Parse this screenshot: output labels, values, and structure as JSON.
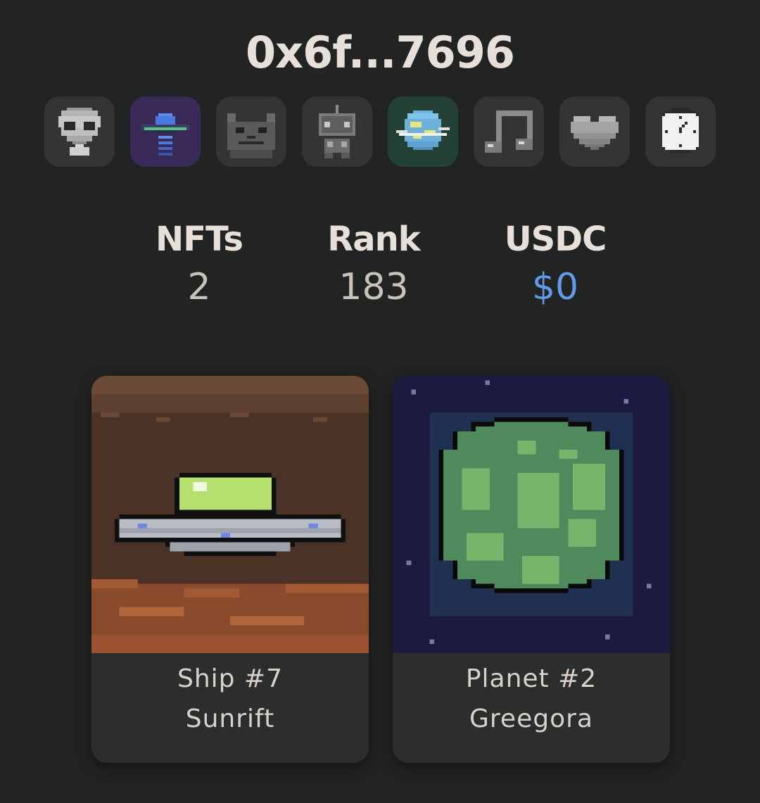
{
  "wallet": {
    "address": "0x6f...7696"
  },
  "badges": [
    {
      "name": "alien",
      "icon": "alien-icon"
    },
    {
      "name": "ufo",
      "icon": "ufo-icon"
    },
    {
      "name": "cat",
      "icon": "cat-icon"
    },
    {
      "name": "robot",
      "icon": "robot-icon"
    },
    {
      "name": "planet",
      "icon": "planet-icon"
    },
    {
      "name": "music",
      "icon": "music-note-icon"
    },
    {
      "name": "heart",
      "icon": "heart-icon"
    },
    {
      "name": "clock",
      "icon": "clock-icon"
    }
  ],
  "stats": {
    "nfts": {
      "label": "NFTs",
      "value": "2"
    },
    "rank": {
      "label": "Rank",
      "value": "183"
    },
    "usdc": {
      "label": "USDC",
      "value": "$0"
    }
  },
  "cards": [
    {
      "title": "Ship #7",
      "subtitle": "Sunrift",
      "art": "ufo-art"
    },
    {
      "title": "Planet #2",
      "subtitle": "Greegora",
      "art": "planet-art"
    }
  ],
  "colors": {
    "background": "#222323",
    "accent_blue": "#5f9be8",
    "card_bg": "#2c2d2d"
  }
}
